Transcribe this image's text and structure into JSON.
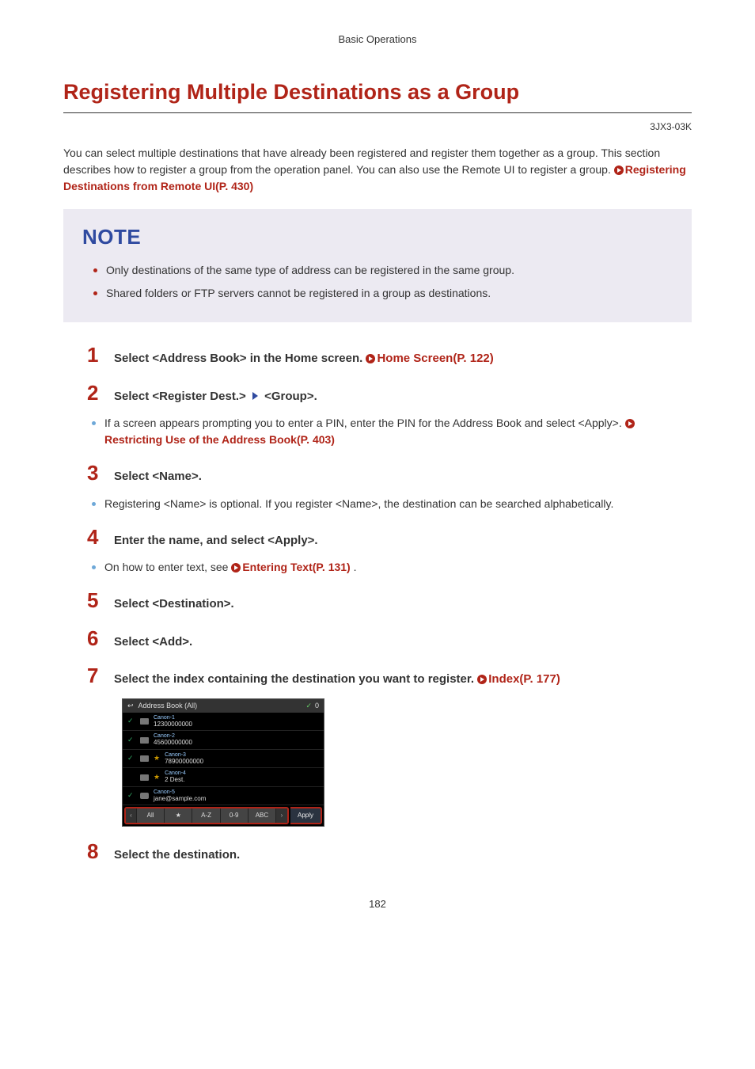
{
  "header": "Basic Operations",
  "title": "Registering Multiple Destinations as a Group",
  "docCode": "3JX3-03K",
  "intro": {
    "text": "You can select multiple destinations that have already been registered and register them together as a group. This section describes how to register a group from the operation panel. You can also use the Remote UI to register a group. ",
    "link": "Registering Destinations from Remote UI(P. 430)"
  },
  "note": {
    "title": "NOTE",
    "items": [
      "Only destinations of the same type of address can be registered in the same group.",
      "Shared folders or FTP servers cannot be registered in a group as destinations."
    ]
  },
  "steps": [
    {
      "num": "1",
      "titlePrefix": "Select <Address Book> in the Home screen. ",
      "titleLink": "Home Screen(P. 122)",
      "body": []
    },
    {
      "num": "2",
      "titleParts": {
        "a": "Select <Register Dest.> ",
        "b": " <Group>."
      },
      "body": [
        {
          "pre": "If a screen appears prompting you to enter a PIN, enter the PIN for the Address Book and select <Apply>. ",
          "boldLinkAfterIcon": "Restricting Use of the Address Book(P. 403)"
        }
      ]
    },
    {
      "num": "3",
      "title": "Select <Name>.",
      "body": [
        {
          "pre": "Registering <Name> is optional. If you register <Name>, the destination can be searched alphabetically."
        }
      ]
    },
    {
      "num": "4",
      "title": "Enter the name, and select <Apply>.",
      "body": [
        {
          "pre": "On how to enter text, see ",
          "linkBold": "Entering Text(P. 131)",
          "post": " ."
        }
      ]
    },
    {
      "num": "5",
      "title": "Select <Destination>.",
      "body": []
    },
    {
      "num": "6",
      "title": "Select <Add>.",
      "body": []
    },
    {
      "num": "7",
      "titlePrefix": "Select the index containing the destination you want to register. ",
      "titleLink": "Index(P. 177)",
      "hasDevice": true,
      "body": []
    },
    {
      "num": "8",
      "title": "Select the destination.",
      "body": []
    }
  ],
  "device": {
    "header": "Address Book (All)",
    "check": "✓",
    "count": "0",
    "rows": [
      {
        "tick": true,
        "icon": "fax",
        "star": false,
        "name": "Canon-1",
        "val": "12300000000"
      },
      {
        "tick": true,
        "icon": "fax",
        "star": false,
        "name": "Canon-2",
        "val": "45600000000"
      },
      {
        "tick": true,
        "icon": "fax",
        "star": true,
        "name": "Canon-3",
        "val": "78900000000"
      },
      {
        "tick": false,
        "icon": "grp",
        "star": true,
        "name": "Canon-4",
        "val": "2 Dest."
      },
      {
        "tick": true,
        "icon": "mail",
        "star": false,
        "name": "Canon-5",
        "val": "jane@sample.com"
      }
    ],
    "tabs": [
      "All",
      "★",
      "A-Z",
      "0-9",
      "ABC"
    ],
    "apply": "Apply"
  },
  "pageNumber": "182"
}
